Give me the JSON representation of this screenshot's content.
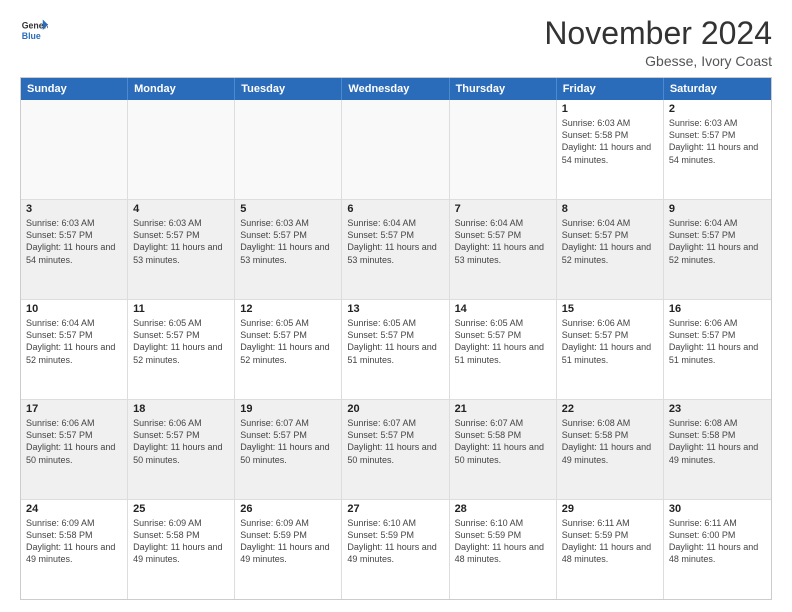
{
  "logo": {
    "line1": "General",
    "line2": "Blue"
  },
  "header": {
    "month": "November 2024",
    "location": "Gbesse, Ivory Coast"
  },
  "weekdays": [
    "Sunday",
    "Monday",
    "Tuesday",
    "Wednesday",
    "Thursday",
    "Friday",
    "Saturday"
  ],
  "weeks": [
    [
      {
        "day": "",
        "empty": true
      },
      {
        "day": "",
        "empty": true
      },
      {
        "day": "",
        "empty": true
      },
      {
        "day": "",
        "empty": true
      },
      {
        "day": "",
        "empty": true
      },
      {
        "day": "1",
        "sunrise": "6:03 AM",
        "sunset": "5:58 PM",
        "daylight": "11 hours and 54 minutes."
      },
      {
        "day": "2",
        "sunrise": "6:03 AM",
        "sunset": "5:57 PM",
        "daylight": "11 hours and 54 minutes."
      }
    ],
    [
      {
        "day": "3",
        "sunrise": "6:03 AM",
        "sunset": "5:57 PM",
        "daylight": "11 hours and 54 minutes."
      },
      {
        "day": "4",
        "sunrise": "6:03 AM",
        "sunset": "5:57 PM",
        "daylight": "11 hours and 53 minutes."
      },
      {
        "day": "5",
        "sunrise": "6:03 AM",
        "sunset": "5:57 PM",
        "daylight": "11 hours and 53 minutes."
      },
      {
        "day": "6",
        "sunrise": "6:04 AM",
        "sunset": "5:57 PM",
        "daylight": "11 hours and 53 minutes."
      },
      {
        "day": "7",
        "sunrise": "6:04 AM",
        "sunset": "5:57 PM",
        "daylight": "11 hours and 53 minutes."
      },
      {
        "day": "8",
        "sunrise": "6:04 AM",
        "sunset": "5:57 PM",
        "daylight": "11 hours and 52 minutes."
      },
      {
        "day": "9",
        "sunrise": "6:04 AM",
        "sunset": "5:57 PM",
        "daylight": "11 hours and 52 minutes."
      }
    ],
    [
      {
        "day": "10",
        "sunrise": "6:04 AM",
        "sunset": "5:57 PM",
        "daylight": "11 hours and 52 minutes."
      },
      {
        "day": "11",
        "sunrise": "6:05 AM",
        "sunset": "5:57 PM",
        "daylight": "11 hours and 52 minutes."
      },
      {
        "day": "12",
        "sunrise": "6:05 AM",
        "sunset": "5:57 PM",
        "daylight": "11 hours and 52 minutes."
      },
      {
        "day": "13",
        "sunrise": "6:05 AM",
        "sunset": "5:57 PM",
        "daylight": "11 hours and 51 minutes."
      },
      {
        "day": "14",
        "sunrise": "6:05 AM",
        "sunset": "5:57 PM",
        "daylight": "11 hours and 51 minutes."
      },
      {
        "day": "15",
        "sunrise": "6:06 AM",
        "sunset": "5:57 PM",
        "daylight": "11 hours and 51 minutes."
      },
      {
        "day": "16",
        "sunrise": "6:06 AM",
        "sunset": "5:57 PM",
        "daylight": "11 hours and 51 minutes."
      }
    ],
    [
      {
        "day": "17",
        "sunrise": "6:06 AM",
        "sunset": "5:57 PM",
        "daylight": "11 hours and 50 minutes."
      },
      {
        "day": "18",
        "sunrise": "6:06 AM",
        "sunset": "5:57 PM",
        "daylight": "11 hours and 50 minutes."
      },
      {
        "day": "19",
        "sunrise": "6:07 AM",
        "sunset": "5:57 PM",
        "daylight": "11 hours and 50 minutes."
      },
      {
        "day": "20",
        "sunrise": "6:07 AM",
        "sunset": "5:57 PM",
        "daylight": "11 hours and 50 minutes."
      },
      {
        "day": "21",
        "sunrise": "6:07 AM",
        "sunset": "5:58 PM",
        "daylight": "11 hours and 50 minutes."
      },
      {
        "day": "22",
        "sunrise": "6:08 AM",
        "sunset": "5:58 PM",
        "daylight": "11 hours and 49 minutes."
      },
      {
        "day": "23",
        "sunrise": "6:08 AM",
        "sunset": "5:58 PM",
        "daylight": "11 hours and 49 minutes."
      }
    ],
    [
      {
        "day": "24",
        "sunrise": "6:09 AM",
        "sunset": "5:58 PM",
        "daylight": "11 hours and 49 minutes."
      },
      {
        "day": "25",
        "sunrise": "6:09 AM",
        "sunset": "5:58 PM",
        "daylight": "11 hours and 49 minutes."
      },
      {
        "day": "26",
        "sunrise": "6:09 AM",
        "sunset": "5:59 PM",
        "daylight": "11 hours and 49 minutes."
      },
      {
        "day": "27",
        "sunrise": "6:10 AM",
        "sunset": "5:59 PM",
        "daylight": "11 hours and 49 minutes."
      },
      {
        "day": "28",
        "sunrise": "6:10 AM",
        "sunset": "5:59 PM",
        "daylight": "11 hours and 48 minutes."
      },
      {
        "day": "29",
        "sunrise": "6:11 AM",
        "sunset": "5:59 PM",
        "daylight": "11 hours and 48 minutes."
      },
      {
        "day": "30",
        "sunrise": "6:11 AM",
        "sunset": "6:00 PM",
        "daylight": "11 hours and 48 minutes."
      }
    ]
  ]
}
